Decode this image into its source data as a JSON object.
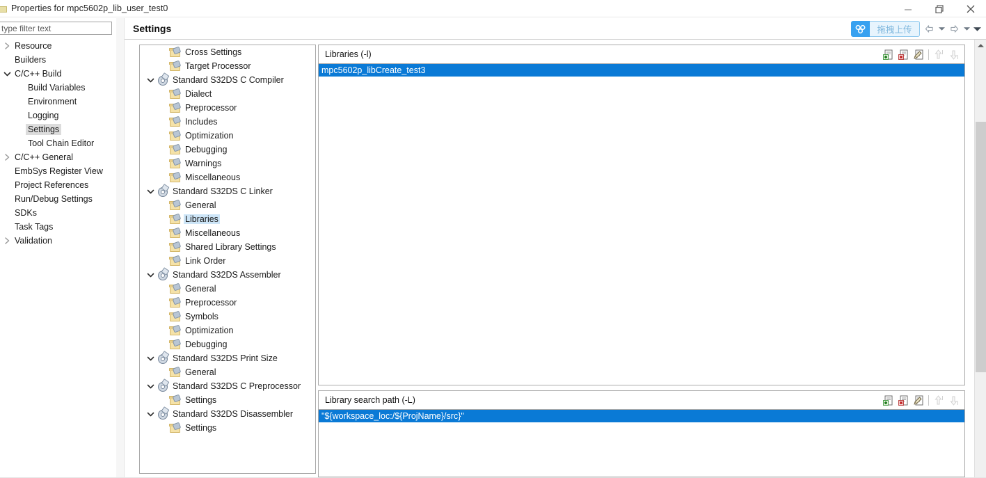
{
  "window": {
    "title": "Properties for mpc5602p_lib_user_test0",
    "icon": "properties-icon",
    "controls": [
      {
        "name": "minimize-button",
        "glyph": "minimize"
      },
      {
        "name": "restore-button",
        "glyph": "restore"
      },
      {
        "name": "close-button",
        "glyph": "close"
      }
    ]
  },
  "filter": {
    "placeholder": "type filter text",
    "value": "type filter text"
  },
  "sidebar": {
    "items": [
      {
        "label": "Resource",
        "indent": 0,
        "twisty": "collapsed",
        "selected": false
      },
      {
        "label": "Builders",
        "indent": 0,
        "twisty": "none",
        "selected": false
      },
      {
        "label": "C/C++ Build",
        "indent": 0,
        "twisty": "expanded",
        "selected": false
      },
      {
        "label": "Build Variables",
        "indent": 1,
        "twisty": "none",
        "selected": false
      },
      {
        "label": "Environment",
        "indent": 1,
        "twisty": "none",
        "selected": false
      },
      {
        "label": "Logging",
        "indent": 1,
        "twisty": "none",
        "selected": false
      },
      {
        "label": "Settings",
        "indent": 1,
        "twisty": "none",
        "selected": true
      },
      {
        "label": "Tool Chain Editor",
        "indent": 1,
        "twisty": "none",
        "selected": false
      },
      {
        "label": "C/C++ General",
        "indent": 0,
        "twisty": "collapsed",
        "selected": false
      },
      {
        "label": "EmbSys Register View",
        "indent": 0,
        "twisty": "none",
        "selected": false
      },
      {
        "label": "Project References",
        "indent": 0,
        "twisty": "none",
        "selected": false
      },
      {
        "label": "Run/Debug Settings",
        "indent": 0,
        "twisty": "none",
        "selected": false
      },
      {
        "label": "SDKs",
        "indent": 0,
        "twisty": "none",
        "selected": false
      },
      {
        "label": "Task Tags",
        "indent": 0,
        "twisty": "none",
        "selected": false
      },
      {
        "label": "Validation",
        "indent": 0,
        "twisty": "collapsed",
        "selected": false
      }
    ]
  },
  "header": {
    "title": "Settings",
    "netdisk_label": "拖拽上传",
    "netdisk_icon": "baidu-netdisk-icon",
    "nav": [
      {
        "name": "nav-back-button",
        "icon": "arrow-left-icon"
      },
      {
        "name": "nav-back-dropdown",
        "icon": "chevron-down-icon"
      },
      {
        "name": "nav-forward-button",
        "icon": "arrow-right-icon"
      },
      {
        "name": "nav-forward-dropdown",
        "icon": "chevron-down-icon"
      },
      {
        "name": "nav-menu-dropdown",
        "icon": "chevron-down-icon"
      }
    ]
  },
  "tree": {
    "items": [
      {
        "label": "Cross Settings",
        "indent": 1,
        "twisty": "none",
        "icon": "folder-tool-icon",
        "selected": false
      },
      {
        "label": "Target Processor",
        "indent": 1,
        "twisty": "none",
        "icon": "folder-tool-icon",
        "selected": false
      },
      {
        "label": "Standard S32DS C Compiler",
        "indent": 0,
        "twisty": "expanded",
        "icon": "toolchain-gear-icon",
        "selected": false
      },
      {
        "label": "Dialect",
        "indent": 1,
        "twisty": "none",
        "icon": "folder-tool-icon",
        "selected": false
      },
      {
        "label": "Preprocessor",
        "indent": 1,
        "twisty": "none",
        "icon": "folder-tool-icon",
        "selected": false
      },
      {
        "label": "Includes",
        "indent": 1,
        "twisty": "none",
        "icon": "folder-tool-icon",
        "selected": false
      },
      {
        "label": "Optimization",
        "indent": 1,
        "twisty": "none",
        "icon": "folder-tool-icon",
        "selected": false
      },
      {
        "label": "Debugging",
        "indent": 1,
        "twisty": "none",
        "icon": "folder-tool-icon",
        "selected": false
      },
      {
        "label": "Warnings",
        "indent": 1,
        "twisty": "none",
        "icon": "folder-tool-icon",
        "selected": false
      },
      {
        "label": "Miscellaneous",
        "indent": 1,
        "twisty": "none",
        "icon": "folder-tool-icon",
        "selected": false
      },
      {
        "label": "Standard S32DS C Linker",
        "indent": 0,
        "twisty": "expanded",
        "icon": "toolchain-gear-icon",
        "selected": false
      },
      {
        "label": "General",
        "indent": 1,
        "twisty": "none",
        "icon": "folder-tool-icon",
        "selected": false
      },
      {
        "label": "Libraries",
        "indent": 1,
        "twisty": "none",
        "icon": "folder-tool-icon",
        "selected": true
      },
      {
        "label": "Miscellaneous",
        "indent": 1,
        "twisty": "none",
        "icon": "folder-tool-icon",
        "selected": false
      },
      {
        "label": "Shared Library Settings",
        "indent": 1,
        "twisty": "none",
        "icon": "folder-tool-icon",
        "selected": false
      },
      {
        "label": "Link Order",
        "indent": 1,
        "twisty": "none",
        "icon": "folder-tool-icon",
        "selected": false
      },
      {
        "label": "Standard S32DS Assembler",
        "indent": 0,
        "twisty": "expanded",
        "icon": "toolchain-gear-icon",
        "selected": false
      },
      {
        "label": "General",
        "indent": 1,
        "twisty": "none",
        "icon": "folder-tool-icon",
        "selected": false
      },
      {
        "label": "Preprocessor",
        "indent": 1,
        "twisty": "none",
        "icon": "folder-tool-icon",
        "selected": false
      },
      {
        "label": "Symbols",
        "indent": 1,
        "twisty": "none",
        "icon": "folder-tool-icon",
        "selected": false
      },
      {
        "label": "Optimization",
        "indent": 1,
        "twisty": "none",
        "icon": "folder-tool-icon",
        "selected": false
      },
      {
        "label": "Debugging",
        "indent": 1,
        "twisty": "none",
        "icon": "folder-tool-icon",
        "selected": false
      },
      {
        "label": "Standard S32DS Print Size",
        "indent": 0,
        "twisty": "expanded",
        "icon": "toolchain-gear-icon",
        "selected": false
      },
      {
        "label": "General",
        "indent": 1,
        "twisty": "none",
        "icon": "folder-tool-icon",
        "selected": false
      },
      {
        "label": "Standard S32DS C Preprocessor",
        "indent": 0,
        "twisty": "expanded",
        "icon": "toolchain-gear-icon",
        "selected": false
      },
      {
        "label": "Settings",
        "indent": 1,
        "twisty": "none",
        "icon": "folder-tool-icon",
        "selected": false
      },
      {
        "label": "Standard S32DS Disassembler",
        "indent": 0,
        "twisty": "expanded",
        "icon": "toolchain-gear-icon",
        "selected": false
      },
      {
        "label": "Settings",
        "indent": 1,
        "twisty": "none",
        "icon": "folder-tool-icon",
        "selected": false
      }
    ]
  },
  "groups": [
    {
      "name": "libraries",
      "title": "Libraries (-l)",
      "rows": [
        {
          "value": "mpc5602p_libCreate_test3",
          "selected": true
        }
      ],
      "tools": [
        {
          "name": "add-button",
          "icon": "add-icon",
          "disabled": false
        },
        {
          "name": "delete-button",
          "icon": "delete-icon",
          "disabled": false
        },
        {
          "name": "edit-button",
          "icon": "edit-icon",
          "disabled": false
        },
        {
          "name": "move-up-button",
          "icon": "arrow-up-icon",
          "disabled": true
        },
        {
          "name": "move-down-button",
          "icon": "arrow-down-icon",
          "disabled": true
        }
      ]
    },
    {
      "name": "library-search-path",
      "title": "Library search path (-L)",
      "rows": [
        {
          "value": "\"${workspace_loc:/${ProjName}/src}\"",
          "selected": true
        }
      ],
      "tools": [
        {
          "name": "add-button",
          "icon": "add-icon",
          "disabled": false
        },
        {
          "name": "delete-button",
          "icon": "delete-icon",
          "disabled": false
        },
        {
          "name": "edit-button",
          "icon": "edit-icon",
          "disabled": false
        },
        {
          "name": "move-up-button",
          "icon": "arrow-up-icon",
          "disabled": true
        },
        {
          "name": "move-down-button",
          "icon": "arrow-down-icon",
          "disabled": true
        }
      ]
    }
  ],
  "colors": {
    "selection_blue": "#0a7ad6",
    "tree_selection": "#cde5f7",
    "sidebar_selection": "#dcdcdc",
    "netdisk_blue": "#38a1f0"
  }
}
